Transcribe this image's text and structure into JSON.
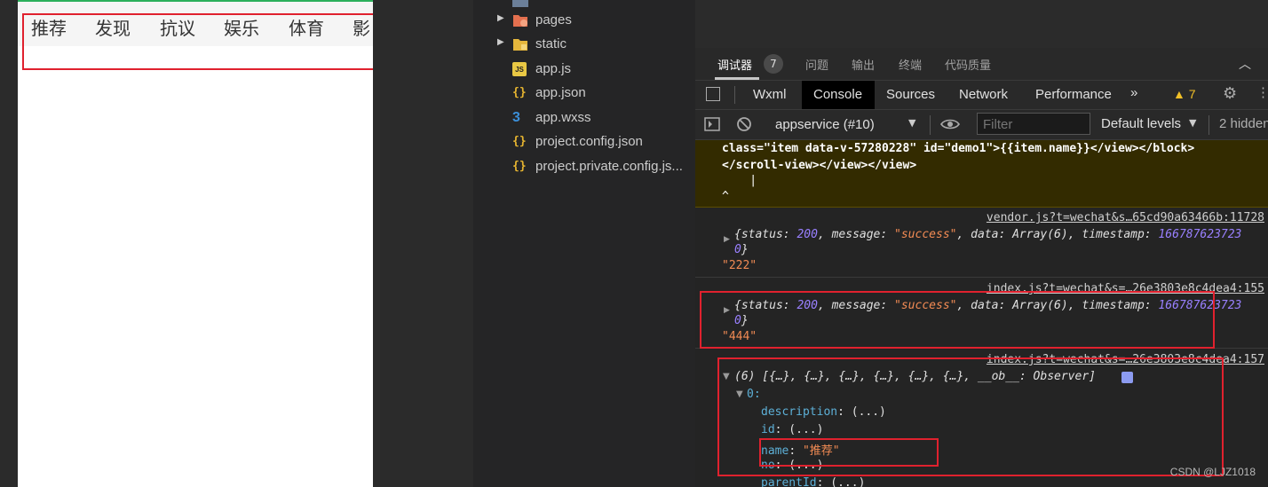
{
  "simulator": {
    "categories": [
      "推荐",
      "发现",
      "抗议",
      "娱乐",
      "体育",
      "影"
    ]
  },
  "file_tree": {
    "items": [
      {
        "label": "pages",
        "type": "folder"
      },
      {
        "label": "static",
        "type": "folder"
      },
      {
        "label": "app.js",
        "type": "js"
      },
      {
        "label": "app.json",
        "type": "json"
      },
      {
        "label": "app.wxss",
        "type": "css"
      },
      {
        "label": "project.config.json",
        "type": "json"
      },
      {
        "label": "project.private.config.js...",
        "type": "json"
      }
    ]
  },
  "devtools": {
    "top_tabs": [
      "调试器",
      "问题",
      "输出",
      "终端",
      "代码质量"
    ],
    "debugger_badge": "7",
    "panel_tabs": [
      "Wxml",
      "Console",
      "Sources",
      "Network",
      "Performance"
    ],
    "more": "»",
    "warnings": "▲ 7",
    "context": "appservice (#10)",
    "filter_placeholder": "Filter",
    "levels": "Default levels",
    "hidden": "2 hidden"
  },
  "console": {
    "warning_lines": [
      "class=\"item data-v-57280228\" id=\"demo1\">{{item.name}}</view></block>",
      "</scroll-view></view></view>",
      "    |",
      "^"
    ],
    "entry1": {
      "source": "vendor.js?t=wechat&s…65cd90a63466b:11728",
      "obj_prefix": "{status: ",
      "status": "200",
      "msg_key": ", message: ",
      "message": "\"success\"",
      "data_part": ", data: Array(6), timestamp: ",
      "timestamp": "166787623723",
      "cont": "0",
      "close": "}",
      "value": "\"222\""
    },
    "entry2": {
      "source": "index.js?t=wechat&s=…26e3803e8c4dea4:155",
      "obj_prefix": "{status: ",
      "status": "200",
      "msg_key": ", message: ",
      "message": "\"success\"",
      "data_part": ", data: Array(6), timestamp: ",
      "timestamp": "166787623723",
      "cont": "0",
      "close": "}",
      "value": "\"444\""
    },
    "entry3": {
      "source": "index.js?t=wechat&s=…26e3803e8c4dea4:157",
      "array_summary": "(6) [{…}, {…}, {…}, {…}, {…}, {…}, __ob__: Observer]",
      "index0": "0:",
      "props": [
        {
          "key": "description",
          "value": ": (...)"
        },
        {
          "key": "id",
          "value": ": (...)"
        },
        {
          "key": "name",
          "value": "\"推荐\""
        },
        {
          "key": "no",
          "value": ": (...)"
        },
        {
          "key": "parentId",
          "value": ": (...)"
        }
      ]
    }
  },
  "watermark": "CSDN @LJZ1018"
}
